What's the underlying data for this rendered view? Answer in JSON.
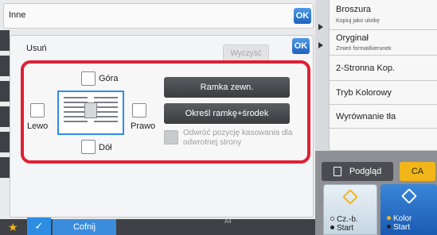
{
  "top_bar": {
    "title": "Inne",
    "ok_label": "OK"
  },
  "dialog": {
    "title": "Usuń",
    "ok_label": "OK",
    "clear_label": "Wyczyść",
    "positions": {
      "top": "Góra",
      "left": "Lewo",
      "right": "Prawo",
      "bottom": "Dół"
    },
    "outer_frame_label": "Ramka zewn.",
    "frame_center_label": "Określ ramkę+środek",
    "reverse_label": "Odwróć pozycję kasowania dla odwrotnej strony"
  },
  "right_panel": {
    "items": [
      {
        "title": "Broszura",
        "subtitle": "Kopiuj jako ulotkę"
      },
      {
        "title": "Oryginał",
        "subtitle": "Zmień format/kierunek"
      },
      {
        "title": "2-Stronna Kop.",
        "subtitle": ""
      },
      {
        "title": "Tryb Kolorowy",
        "subtitle": ""
      },
      {
        "title": "Wyrównanie tła",
        "subtitle": ""
      }
    ],
    "preview_label": "Podgląd",
    "ca_label": "CA",
    "start_bw": {
      "line1": "Cz.-b.",
      "line2": "Start"
    },
    "start_color": {
      "line1": "Kolor",
      "line2": "Start"
    }
  },
  "bottom_bar": {
    "back_label": "Cofnij",
    "zoom_hint": "A4"
  },
  "colors": {
    "accent_blue": "#2d8de3",
    "highlight_red": "#e02034",
    "ca_yellow": "#f2b51a"
  },
  "icons": [
    "shield-icon",
    "star-icon",
    "check-icon",
    "preview-icon",
    "start-diamond-icon",
    "arrow-right-icon"
  ]
}
